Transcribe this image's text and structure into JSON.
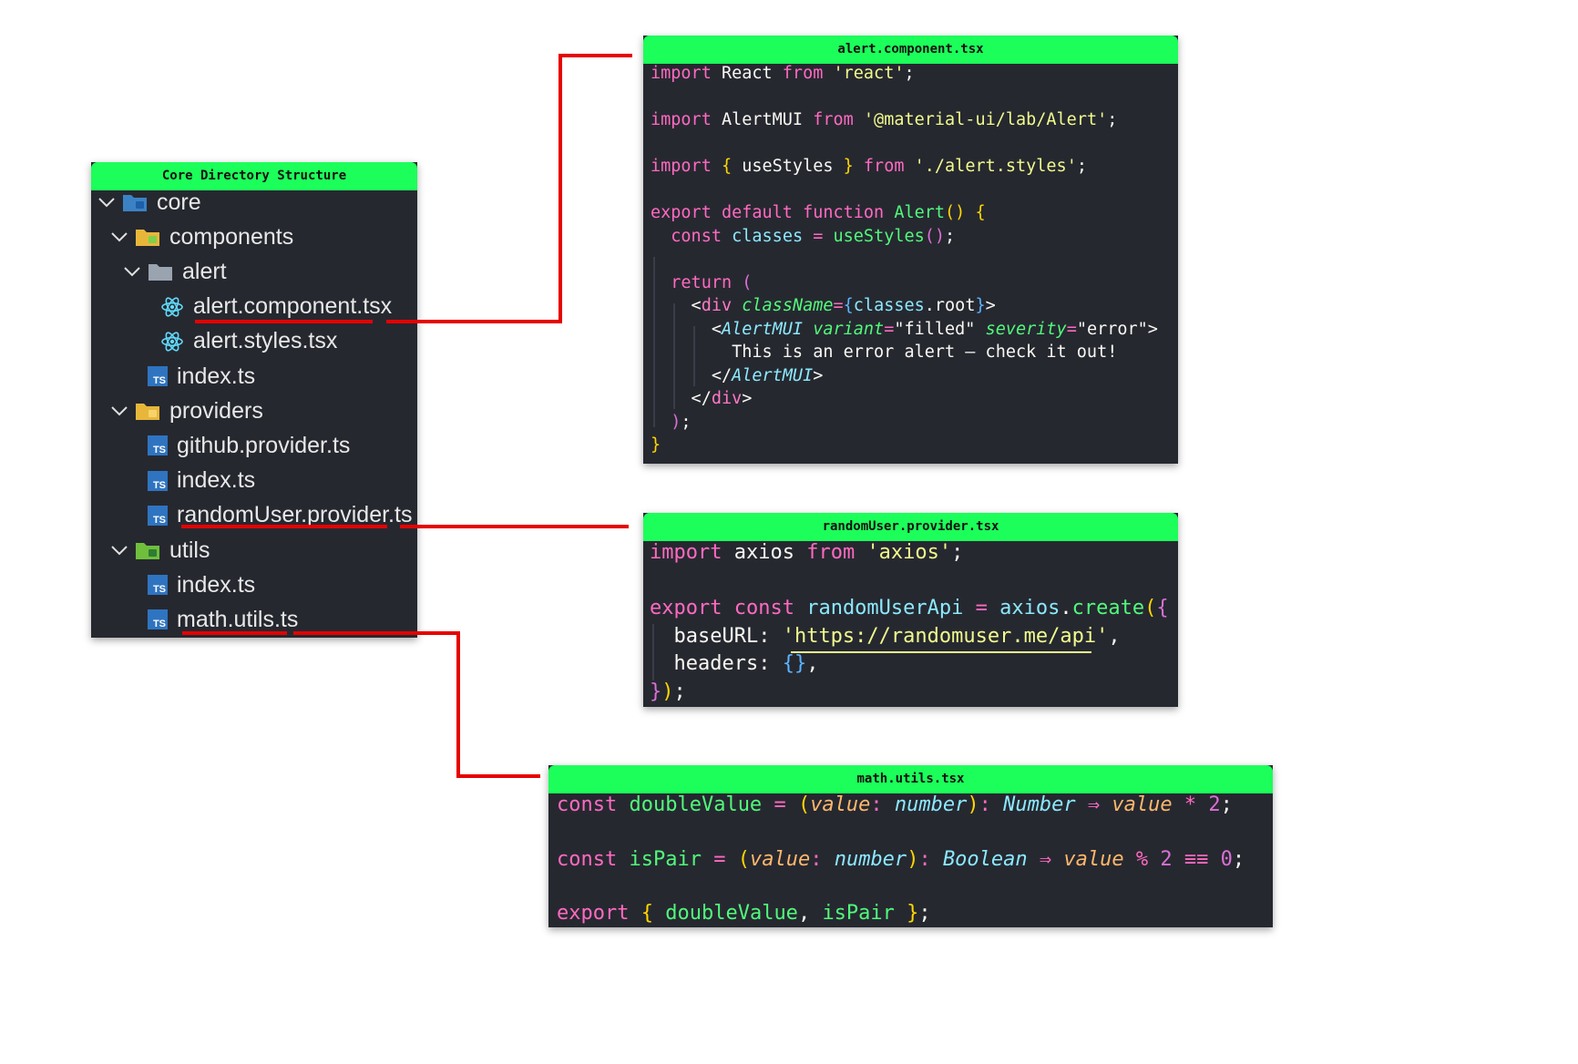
{
  "tree": {
    "title": "Core Directory Structure",
    "items": [
      {
        "label": "core",
        "level": 0,
        "expanded": true,
        "icon": "core-folder-icon"
      },
      {
        "label": "components",
        "level": 1,
        "expanded": true,
        "icon": "components-folder-icon"
      },
      {
        "label": "alert",
        "level": 2,
        "expanded": true,
        "icon": "folder-icon"
      },
      {
        "label": "alert.component.tsx",
        "level": 3,
        "icon": "react-icon"
      },
      {
        "label": "alert.styles.tsx",
        "level": 3,
        "icon": "react-icon"
      },
      {
        "label": "index.ts",
        "level": 2,
        "icon": "ts-icon"
      },
      {
        "label": "providers",
        "level": 1,
        "expanded": true,
        "icon": "providers-folder-icon"
      },
      {
        "label": "github.provider.ts",
        "level": 2,
        "icon": "ts-icon"
      },
      {
        "label": "index.ts",
        "level": 2,
        "icon": "ts-icon"
      },
      {
        "label": "randomUser.provider.ts",
        "level": 2,
        "icon": "ts-icon"
      },
      {
        "label": "utils",
        "level": 1,
        "expanded": true,
        "icon": "utils-folder-icon"
      },
      {
        "label": "index.ts",
        "level": 2,
        "icon": "ts-icon"
      },
      {
        "label": "math.utils.ts",
        "level": 2,
        "icon": "ts-icon"
      }
    ]
  },
  "files": {
    "alert": {
      "title": "alert.component.tsx",
      "lines": [
        [
          [
            "k",
            "import"
          ],
          [
            "w",
            " React "
          ],
          [
            "k",
            "from"
          ],
          [
            "w",
            " "
          ],
          [
            "s",
            "'react'"
          ],
          [
            "w",
            ";"
          ]
        ],
        [],
        [
          [
            "k",
            "import"
          ],
          [
            "w",
            " AlertMUI "
          ],
          [
            "k",
            "from"
          ],
          [
            "w",
            " "
          ],
          [
            "s",
            "'@material-ui/lab/Alert'"
          ],
          [
            "w",
            ";"
          ]
        ],
        [],
        [
          [
            "k",
            "import"
          ],
          [
            "w",
            " "
          ],
          [
            "b1",
            "{"
          ],
          [
            "w",
            " useStyles "
          ],
          [
            "b1",
            "}"
          ],
          [
            "w",
            " "
          ],
          [
            "k",
            "from"
          ],
          [
            "w",
            " "
          ],
          [
            "s",
            "'./alert.styles'"
          ],
          [
            "w",
            ";"
          ]
        ],
        [],
        [
          [
            "k",
            "export default function"
          ],
          [
            "w",
            " "
          ],
          [
            "f",
            "Alert"
          ],
          [
            "b1",
            "()"
          ],
          [
            "w",
            " "
          ],
          [
            "b1",
            "{"
          ]
        ],
        [
          [
            "w",
            "  "
          ],
          [
            "k",
            "const"
          ],
          [
            "w",
            " "
          ],
          [
            "t",
            "classes"
          ],
          [
            "w",
            " "
          ],
          [
            "k",
            "="
          ],
          [
            "w",
            " "
          ],
          [
            "f",
            "useStyles"
          ],
          [
            "b2",
            "()"
          ],
          [
            "w",
            ";"
          ]
        ],
        [],
        [
          [
            "w",
            "  "
          ],
          [
            "k",
            "return"
          ],
          [
            "w",
            " "
          ],
          [
            "b2",
            "("
          ]
        ],
        [
          [
            "w",
            "    <"
          ],
          [
            "pk",
            "div"
          ],
          [
            "w",
            " "
          ],
          [
            "f i",
            "className"
          ],
          [
            "k",
            "="
          ],
          [
            "b3",
            "{"
          ],
          [
            "t",
            "classes"
          ],
          [
            "w",
            ".root"
          ],
          [
            "b3",
            "}"
          ],
          [
            "w",
            ">"
          ]
        ],
        [
          [
            "w",
            "      <"
          ],
          [
            "t i",
            "AlertMUI"
          ],
          [
            "w",
            " "
          ],
          [
            "f i",
            "variant"
          ],
          [
            "k",
            "="
          ],
          [
            "w",
            "\"filled\" "
          ],
          [
            "f i",
            "severity"
          ],
          [
            "k",
            "="
          ],
          [
            "w",
            "\"error\">"
          ]
        ],
        [
          [
            "w",
            "        This is an error alert — check it out!"
          ]
        ],
        [
          [
            "w",
            "      </"
          ],
          [
            "t i",
            "AlertMUI"
          ],
          [
            "w",
            ">"
          ]
        ],
        [
          [
            "w",
            "    </"
          ],
          [
            "pk",
            "div"
          ],
          [
            "w",
            ">"
          ]
        ],
        [
          [
            "w",
            "  "
          ],
          [
            "b2",
            ")"
          ],
          [
            "w",
            ";"
          ]
        ],
        [
          [
            "b1",
            "}"
          ]
        ]
      ]
    },
    "provider": {
      "title": "randomUser.provider.tsx",
      "lines": [
        [
          [
            "k",
            "import"
          ],
          [
            "w",
            " axios "
          ],
          [
            "k",
            "from"
          ],
          [
            "w",
            " "
          ],
          [
            "s",
            "'axios'"
          ],
          [
            "w",
            ";"
          ]
        ],
        [],
        [
          [
            "k",
            "export const"
          ],
          [
            "w",
            " "
          ],
          [
            "t",
            "randomUserApi"
          ],
          [
            "w",
            " "
          ],
          [
            "k",
            "="
          ],
          [
            "w",
            " "
          ],
          [
            "t",
            "axios"
          ],
          [
            "w",
            "."
          ],
          [
            "f",
            "create"
          ],
          [
            "b1",
            "("
          ],
          [
            "b2",
            "{"
          ]
        ],
        [
          [
            "w",
            "  baseURL: "
          ],
          [
            "s",
            "'https://randomuser.me/api'"
          ],
          [
            "w",
            ","
          ]
        ],
        [
          [
            "w",
            "  headers: "
          ],
          [
            "b3",
            "{}"
          ],
          [
            "w",
            ","
          ]
        ],
        [
          [
            "b2",
            "}"
          ],
          [
            "b1",
            ")"
          ],
          [
            "w",
            ";"
          ]
        ]
      ]
    },
    "math": {
      "title": "math.utils.tsx",
      "lines": [
        [
          [
            "k",
            "const"
          ],
          [
            "w",
            " "
          ],
          [
            "f",
            "doubleValue"
          ],
          [
            "w",
            " "
          ],
          [
            "k",
            "="
          ],
          [
            "w",
            " "
          ],
          [
            "b1",
            "("
          ],
          [
            "p i",
            "value"
          ],
          [
            "k",
            ":"
          ],
          [
            "w",
            " "
          ],
          [
            "t i",
            "number"
          ],
          [
            "b1",
            ")"
          ],
          [
            "k",
            ":"
          ],
          [
            "w",
            " "
          ],
          [
            "t i",
            "Number"
          ],
          [
            "w",
            " "
          ],
          [
            "k",
            "⇒"
          ],
          [
            "w",
            " "
          ],
          [
            "p i",
            "value"
          ],
          [
            "w",
            " "
          ],
          [
            "k",
            "*"
          ],
          [
            "w",
            " "
          ],
          [
            "b2",
            "2"
          ],
          [
            "w",
            ";"
          ]
        ],
        [],
        [
          [
            "k",
            "const"
          ],
          [
            "w",
            " "
          ],
          [
            "f",
            "isPair"
          ],
          [
            "w",
            " "
          ],
          [
            "k",
            "="
          ],
          [
            "w",
            " "
          ],
          [
            "b1",
            "("
          ],
          [
            "p i",
            "value"
          ],
          [
            "k",
            ":"
          ],
          [
            "w",
            " "
          ],
          [
            "t i",
            "number"
          ],
          [
            "b1",
            ")"
          ],
          [
            "k",
            ":"
          ],
          [
            "w",
            " "
          ],
          [
            "t i",
            "Boolean"
          ],
          [
            "w",
            " "
          ],
          [
            "k",
            "⇒"
          ],
          [
            "w",
            " "
          ],
          [
            "p i",
            "value"
          ],
          [
            "w",
            " "
          ],
          [
            "k",
            "%"
          ],
          [
            "w",
            " "
          ],
          [
            "b2",
            "2"
          ],
          [
            "w",
            " "
          ],
          [
            "k",
            "≡≡"
          ],
          [
            "w",
            " "
          ],
          [
            "b2",
            "0"
          ],
          [
            "w",
            ";"
          ]
        ],
        [],
        [
          [
            "k",
            "export"
          ],
          [
            "w",
            " "
          ],
          [
            "b1",
            "{"
          ],
          [
            "w",
            " "
          ],
          [
            "f",
            "doubleValue"
          ],
          [
            "w",
            ", "
          ],
          [
            "f",
            "isPair"
          ],
          [
            "w",
            " "
          ],
          [
            "b1",
            "}"
          ],
          [
            "w",
            ";"
          ]
        ]
      ]
    }
  },
  "colors": {
    "header": "#1cff5a",
    "panel": "#262830",
    "connector": "#e60000"
  }
}
